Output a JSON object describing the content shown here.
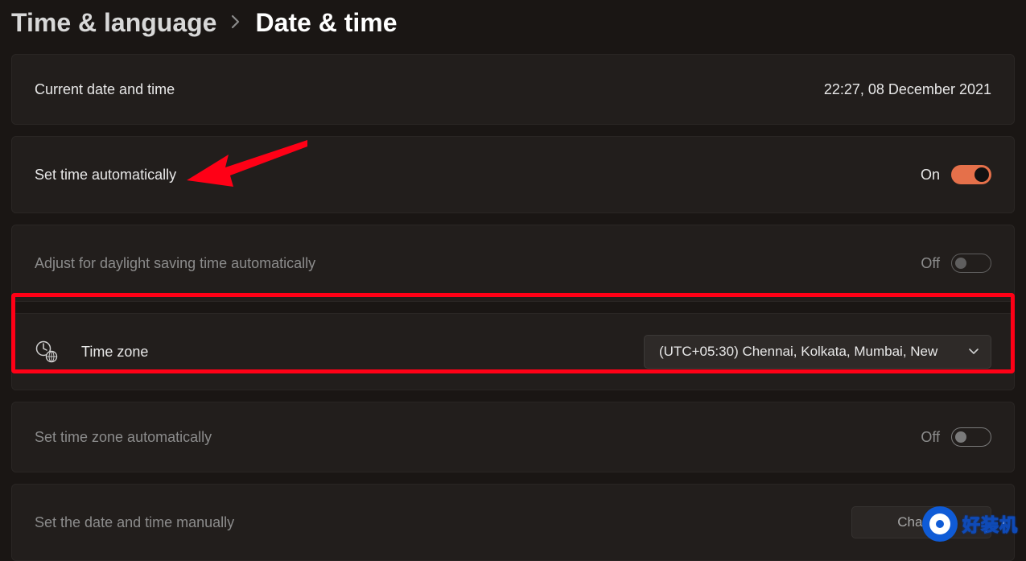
{
  "breadcrumb": {
    "parent": "Time & language",
    "current": "Date & time"
  },
  "current_datetime": {
    "label": "Current date and time",
    "value": "22:27, 08 December 2021"
  },
  "set_time_auto": {
    "label": "Set time automatically",
    "state_text": "On",
    "enabled": true,
    "on": true
  },
  "dst_auto": {
    "label": "Adjust for daylight saving time automatically",
    "state_text": "Off",
    "enabled": false,
    "on": false
  },
  "timezone": {
    "label": "Time zone",
    "selected": "(UTC+05:30) Chennai, Kolkata, Mumbai, New"
  },
  "tz_auto": {
    "label": "Set time zone automatically",
    "state_text": "Off",
    "enabled": true,
    "on": false
  },
  "manual": {
    "label": "Set the date and time manually",
    "button": "Change",
    "button_enabled": false
  },
  "watermark": {
    "text": "好装机"
  },
  "annotation": {
    "highlight_row": "timezone",
    "arrow_target": "set_time_auto"
  }
}
